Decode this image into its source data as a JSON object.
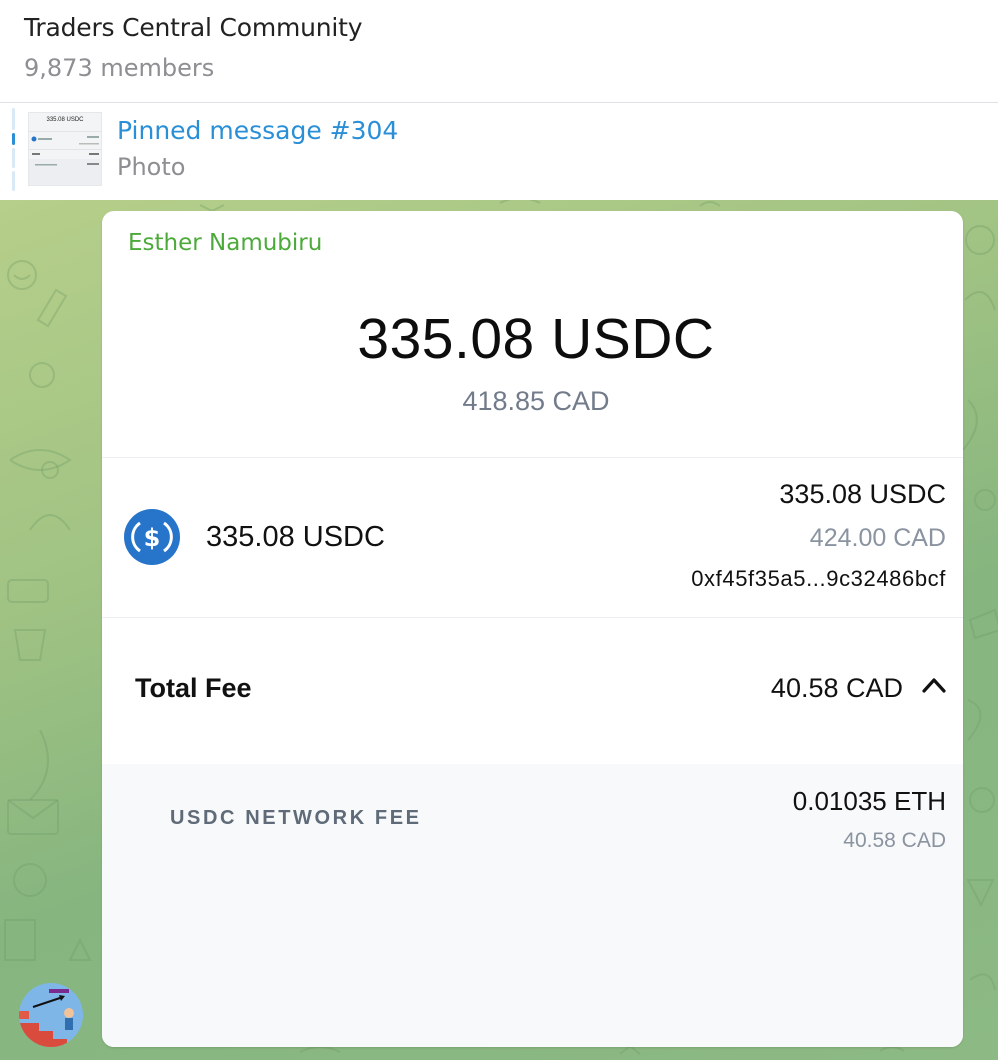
{
  "header": {
    "title": "Traders Central Community",
    "members": "9,873 members"
  },
  "pinned": {
    "title": "Pinned message #304",
    "subtitle": "Photo",
    "thumb_text": "335.08 USDC"
  },
  "message": {
    "sender": "Esther Namubiru",
    "sender_color": "#4caa3a",
    "amount": "335.08 USDC",
    "amount_fiat": "418.85 CAD",
    "asset": {
      "icon": "usdc-coin-icon",
      "name": "335.08 USDC",
      "amount": "335.08 USDC",
      "fiat": "424.00 CAD",
      "address": "0xf45f35a5...9c32486bcf"
    },
    "total_fee": {
      "label": "Total Fee",
      "value": "40.58 CAD",
      "toggle_icon": "chevron-up-icon"
    },
    "network_fee": {
      "label": "USDC NETWORK FEE",
      "amount": "0.01035 ETH",
      "fiat": "40.58 CAD"
    }
  },
  "colors": {
    "accent_blue": "#2a8fd6",
    "usdc_blue": "#2775ca",
    "chat_bg": "#9fc283"
  }
}
